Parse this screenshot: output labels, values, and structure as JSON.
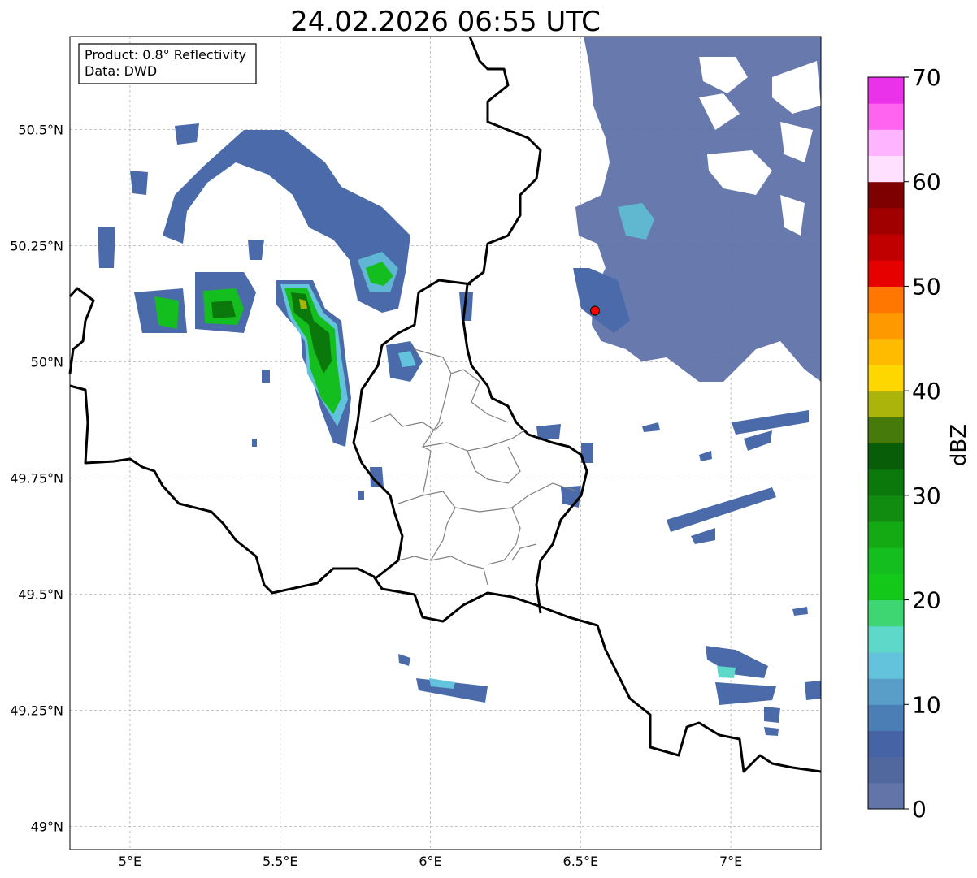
{
  "title": "24.02.2026 06:55 UTC",
  "info_box": {
    "product": "Product: 0.8° Reflectivity",
    "data": "Data: DWD"
  },
  "map": {
    "lon_range": [
      4.8,
      7.3
    ],
    "lat_range": [
      48.95,
      50.7
    ],
    "lon_ticks": [
      {
        "value": 5.0,
        "label": "5°E"
      },
      {
        "value": 5.5,
        "label": "5.5°E"
      },
      {
        "value": 6.0,
        "label": "6°E"
      },
      {
        "value": 6.5,
        "label": "6.5°E"
      },
      {
        "value": 7.0,
        "label": "7°E"
      }
    ],
    "lat_ticks": [
      {
        "value": 49.0,
        "label": "49°N"
      },
      {
        "value": 49.25,
        "label": "49.25°N"
      },
      {
        "value": 49.5,
        "label": "49.5°N"
      },
      {
        "value": 49.75,
        "label": "49.75°N"
      },
      {
        "value": 50.0,
        "label": "50°N"
      },
      {
        "value": 50.25,
        "label": "50.25°N"
      },
      {
        "value": 50.5,
        "label": "50.5°N"
      }
    ],
    "grid": true,
    "radar_site": {
      "lon": 6.548,
      "lat": 50.11,
      "color": "#ff0000"
    }
  },
  "colorbar": {
    "label": "dBZ",
    "min": 0,
    "max": 70,
    "step": 2.5,
    "ticks": [
      0,
      10,
      20,
      30,
      40,
      50,
      60,
      70
    ],
    "colors": [
      "#6374a8",
      "#51689e",
      "#4663a5",
      "#4a7eb4",
      "#599ec8",
      "#64c3dc",
      "#5ed8c8",
      "#3ed672",
      "#14c81a",
      "#14be1e",
      "#14aa14",
      "#118c11",
      "#0b780b",
      "#085e08",
      "#467a0a",
      "#aab40a",
      "#ffd700",
      "#ffbb00",
      "#ff9900",
      "#ff7700",
      "#e60000",
      "#c00000",
      "#a00000",
      "#7e0000",
      "#ffe0ff",
      "#ffb4ff",
      "#ff64f0",
      "#eb32eb"
    ]
  }
}
